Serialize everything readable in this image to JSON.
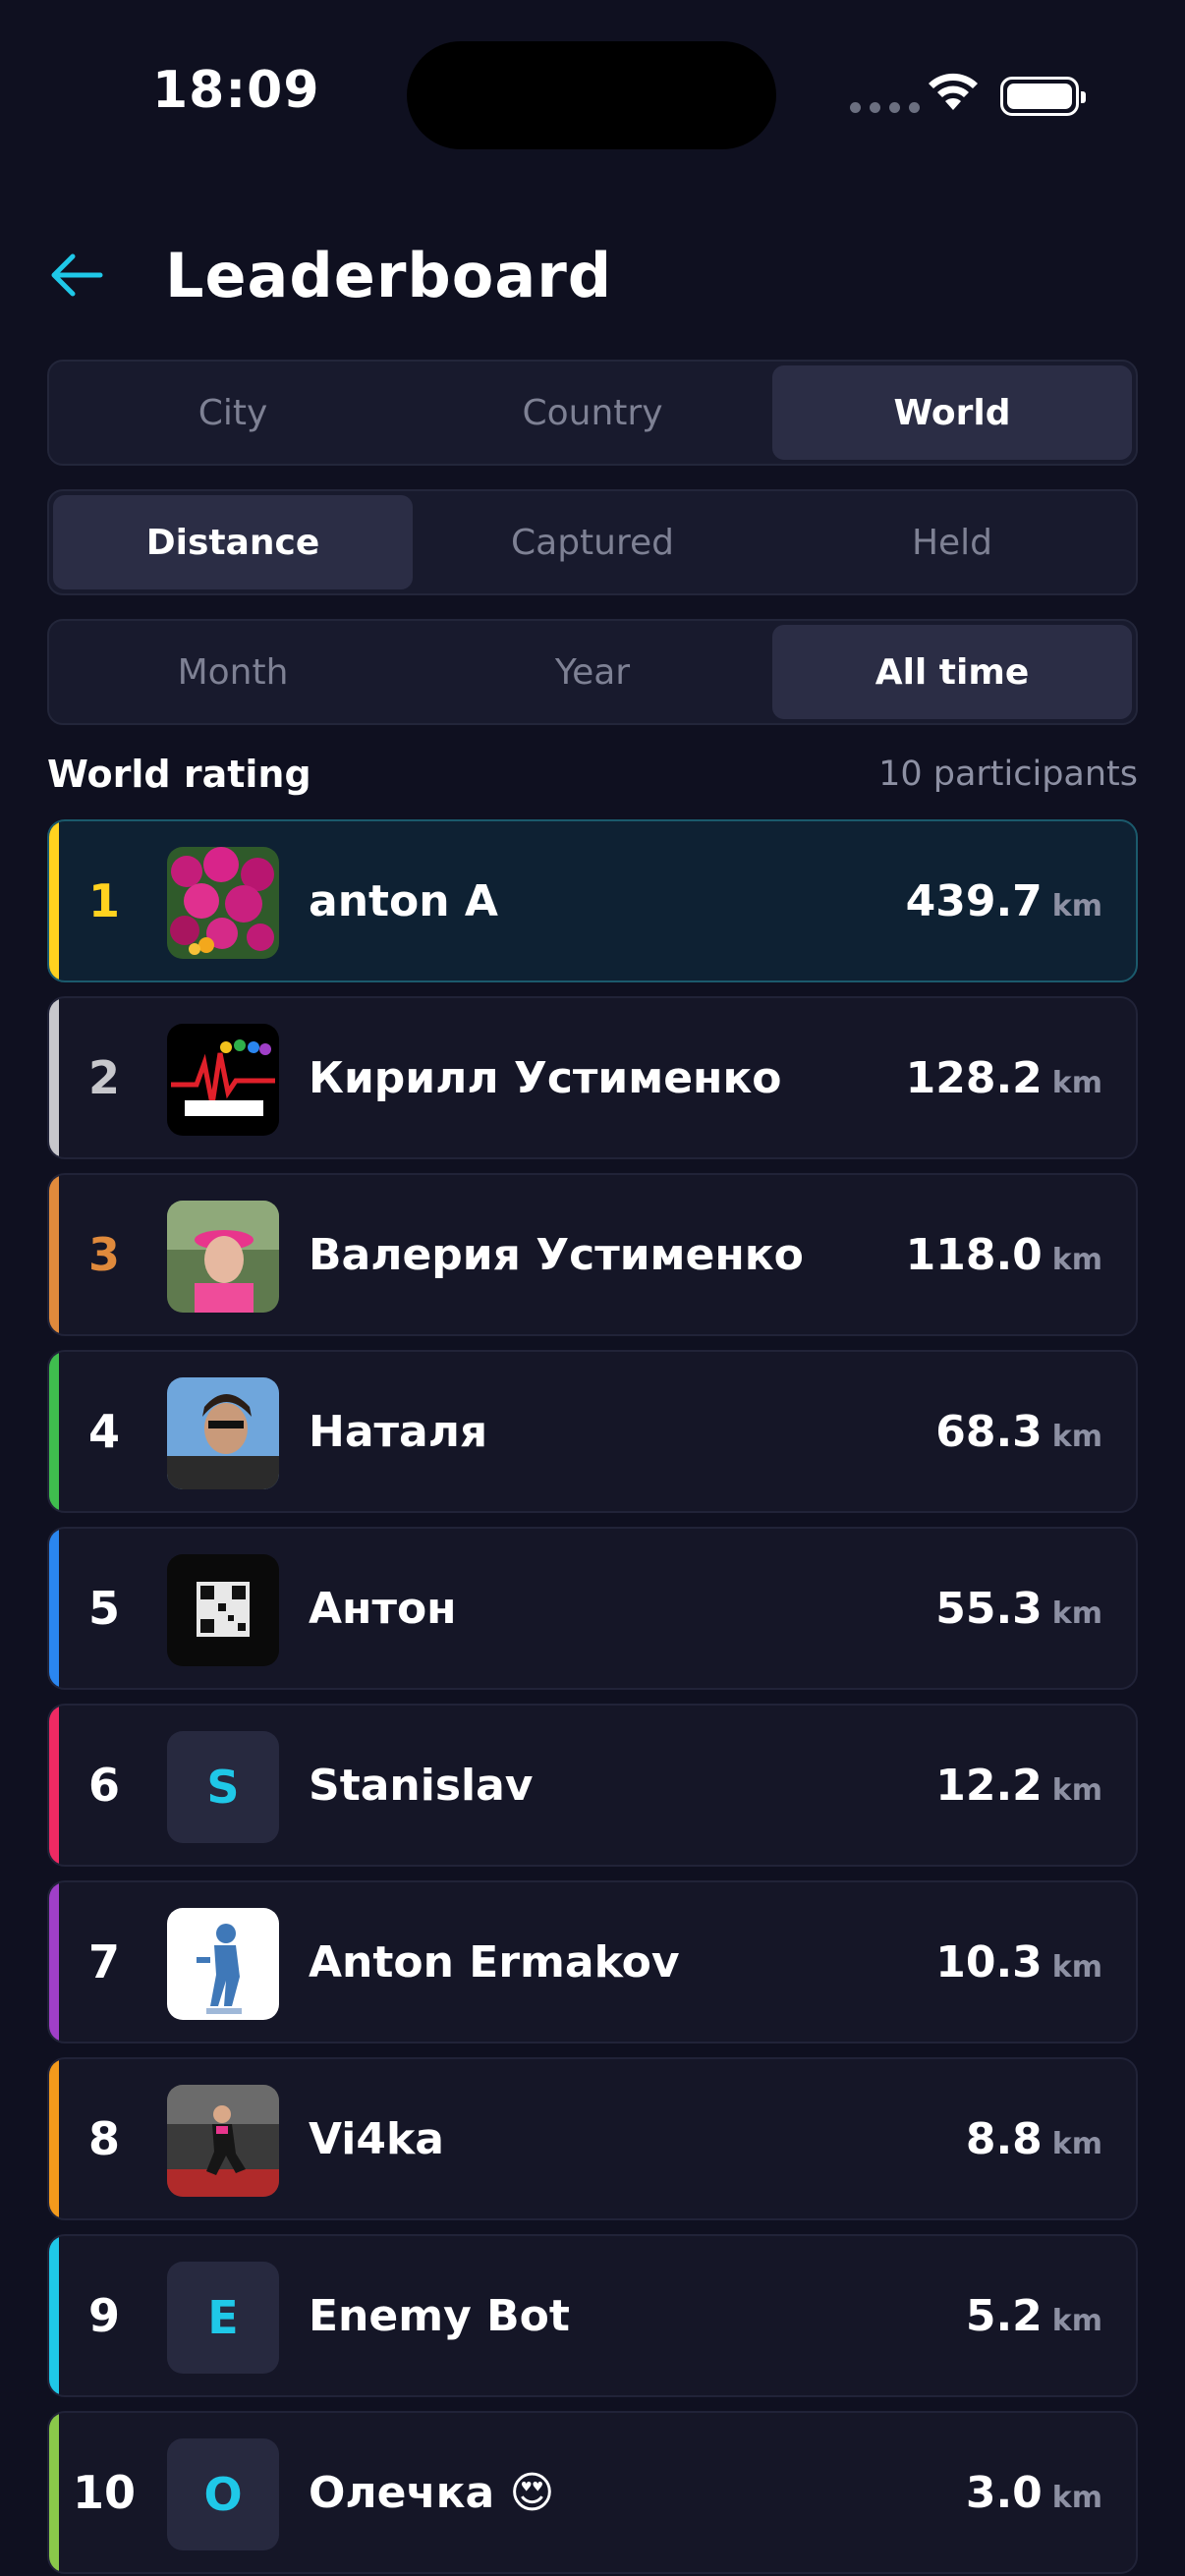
{
  "status_bar": {
    "time": "18:09"
  },
  "header": {
    "title": "Leaderboard"
  },
  "scope_tabs": [
    {
      "label": "City",
      "active": false
    },
    {
      "label": "Country",
      "active": false
    },
    {
      "label": "World",
      "active": true
    }
  ],
  "metric_tabs": [
    {
      "label": "Distance",
      "active": true
    },
    {
      "label": "Captured",
      "active": false
    },
    {
      "label": "Held",
      "active": false
    }
  ],
  "period_tabs": [
    {
      "label": "Month",
      "active": false
    },
    {
      "label": "Year",
      "active": false
    },
    {
      "label": "All time",
      "active": true
    }
  ],
  "rating": {
    "title": "World rating",
    "count": "10 participants"
  },
  "colors": {
    "gold": "#ffd21f",
    "silver": "#c7c7cc",
    "bronze": "#e08a3c",
    "green": "#3fbd4e",
    "blue": "#2a86f0",
    "pink": "#ef2a63",
    "purple": "#a03fc8",
    "orange": "#f39a1c",
    "cyan": "#1fc8e8",
    "lime": "#8ac84a"
  },
  "participants": [
    {
      "rank": "1",
      "name": "anton A",
      "distance": "439.7",
      "unit": "km",
      "avatar": "flowers-photo"
    },
    {
      "rank": "2",
      "name": "Кирилл Устименко",
      "distance": "128.2",
      "unit": "km",
      "avatar": "runners-logo"
    },
    {
      "rank": "3",
      "name": "Валерия Устименко",
      "distance": "118.0",
      "unit": "km",
      "avatar": "woman-photo"
    },
    {
      "rank": "4",
      "name": "Наталя",
      "distance": "68.3",
      "unit": "km",
      "avatar": "selfie-photo"
    },
    {
      "rank": "5",
      "name": "Антон",
      "distance": "55.3",
      "unit": "km",
      "avatar": "qr-photo"
    },
    {
      "rank": "6",
      "name": "Stanislav",
      "distance": "12.2",
      "unit": "km",
      "avatar_letter": "S"
    },
    {
      "rank": "7",
      "name": "Anton Ermakov",
      "distance": "10.3",
      "unit": "km",
      "avatar": "fitness-logo"
    },
    {
      "rank": "8",
      "name": "Vi4ka",
      "distance": "8.8",
      "unit": "km",
      "avatar": "gym-photo"
    },
    {
      "rank": "9",
      "name": "Enemy Bot",
      "distance": "5.2",
      "unit": "km",
      "avatar_letter": "E"
    },
    {
      "rank": "10",
      "name": "Олечка 😍",
      "distance": "3.0",
      "unit": "km",
      "avatar_letter": "О"
    }
  ]
}
